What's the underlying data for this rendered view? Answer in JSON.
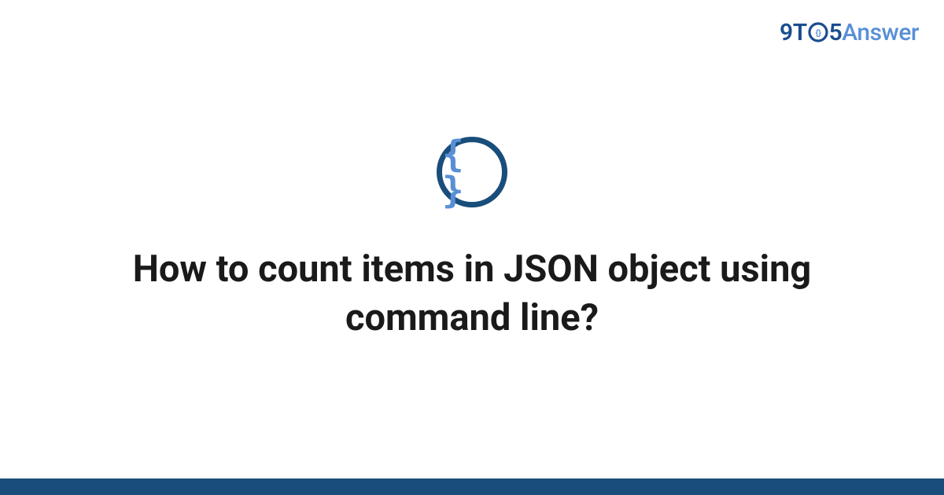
{
  "logo": {
    "nine": "9",
    "t": "T",
    "five": "5",
    "answer": "Answer"
  },
  "icon": {
    "braces": "{ }"
  },
  "title": "How to count items in JSON object using command line?"
}
